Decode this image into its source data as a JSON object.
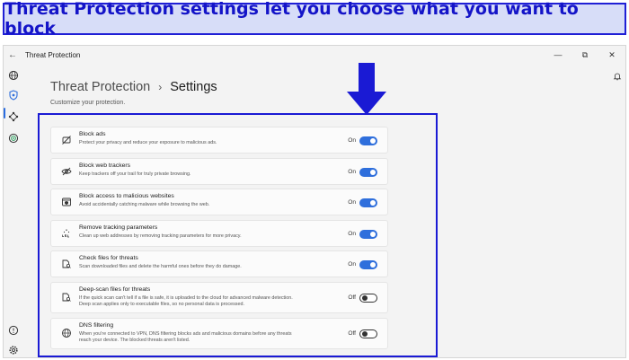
{
  "banner": {
    "text": "Threat Protection settings let you choose what you want to block"
  },
  "window": {
    "title": "Threat Protection",
    "controls": [
      "—",
      "⧉",
      "✕"
    ]
  },
  "header": {
    "breadcrumb_parent": "Threat Protection",
    "breadcrumb_separator": "›",
    "breadcrumb_current": "Settings",
    "subtitle": "Customize your protection."
  },
  "settings": [
    {
      "title": "Block ads",
      "desc": [
        "Protect your privacy and reduce your exposure to malicious ads."
      ],
      "state": "On",
      "enabled": true,
      "icon": "ad-block-icon"
    },
    {
      "title": "Block web trackers",
      "desc": [
        "Keep trackers off your trail for truly private browsing."
      ],
      "state": "On",
      "enabled": true,
      "icon": "eye-slash-icon"
    },
    {
      "title": "Block access to malicious websites",
      "desc": [
        "Avoid accidentally catching malware while browsing the web."
      ],
      "state": "On",
      "enabled": true,
      "icon": "browser-shield-icon"
    },
    {
      "title": "Remove tracking parameters",
      "desc": [
        "Clean up web addresses by removing tracking parameters for more privacy."
      ],
      "state": "On",
      "enabled": true,
      "icon": "url-icon"
    },
    {
      "title": "Check files for threats",
      "desc": [
        "Scan downloaded files and delete the harmful ones before they do damage."
      ],
      "state": "On",
      "enabled": true,
      "icon": "file-scan-icon"
    },
    {
      "title": "Deep-scan files for threats",
      "desc": [
        "If the quick scan can't tell if a file is safe, it is uploaded to the cloud for advanced malware detection.",
        "Deep scan applies only to executable files, so no personal data is processed."
      ],
      "state": "Off",
      "enabled": false,
      "icon": "cloud-scan-icon"
    },
    {
      "title": "DNS filtering",
      "desc": [
        "When you're connected to VPN, DNS filtering blocks ads and malicious domains before any threats",
        "reach your device. The blocked threats aren't listed."
      ],
      "state": "Off",
      "enabled": false,
      "icon": "globe-icon"
    }
  ],
  "colors": {
    "accent": "#2f6fdc",
    "annotation": "#1a1ad4",
    "banner_bg": "#d7ddf8"
  }
}
